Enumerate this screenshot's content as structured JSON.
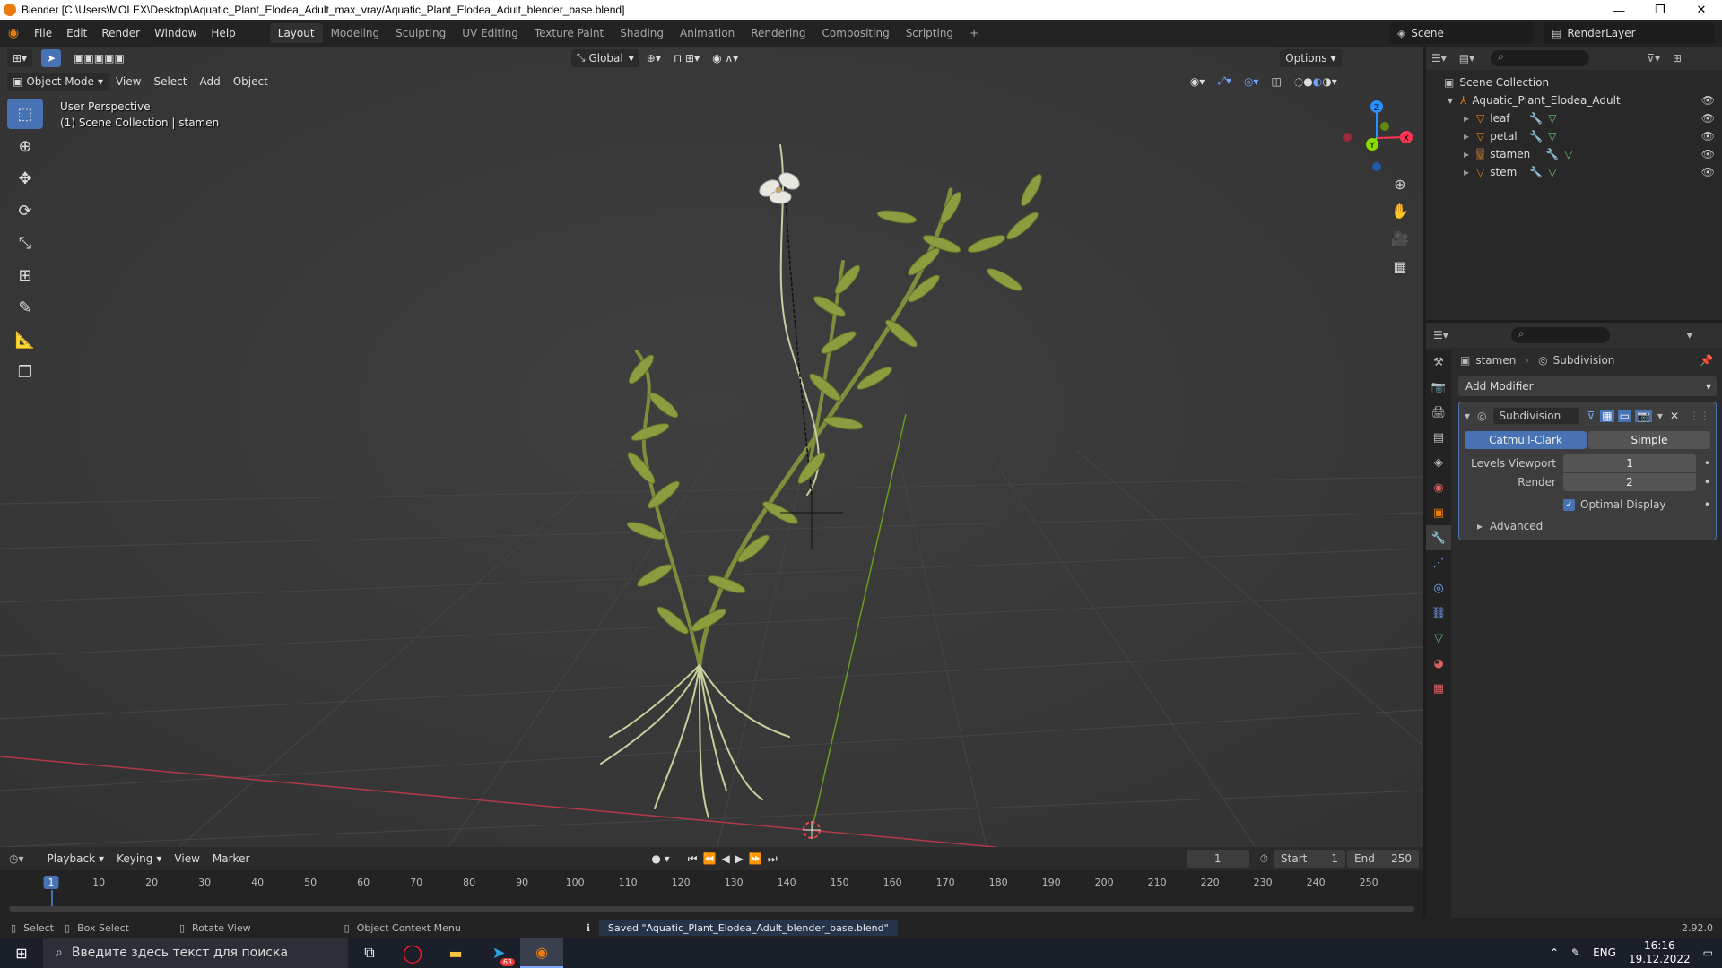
{
  "window": {
    "title": "Blender [C:\\Users\\MOLEX\\Desktop\\Aquatic_Plant_Elodea_Adult_max_vray/Aquatic_Plant_Elodea_Adult_blender_base.blend]",
    "minimize": "—",
    "restore": "❐",
    "close": "✕"
  },
  "menu": [
    "File",
    "Edit",
    "Render",
    "Window",
    "Help"
  ],
  "workspaces": [
    "Layout",
    "Modeling",
    "Sculpting",
    "UV Editing",
    "Texture Paint",
    "Shading",
    "Animation",
    "Rendering",
    "Compositing",
    "Scripting"
  ],
  "add_workspace": "+",
  "scene": {
    "name": "Scene",
    "render_layer": "RenderLayer"
  },
  "viewport": {
    "mode": "Object Mode",
    "menu": [
      "View",
      "Select",
      "Add",
      "Object"
    ],
    "orientation": "Global",
    "options": "Options",
    "info_line1": "User Perspective",
    "info_line2": "(1) Scene Collection | stamen",
    "gizmo": {
      "z": "Z",
      "y": "Y",
      "x": "X"
    }
  },
  "icons": {
    "tools": [
      "select-box-icon",
      "cursor-icon",
      "move-icon",
      "rotate-icon",
      "scale-icon",
      "transform-icon",
      "annotate-icon",
      "measure-icon",
      "add-cube-icon"
    ],
    "nav": [
      "zoom-icon",
      "pan-hand-icon",
      "camera-icon",
      "grid-icon"
    ]
  },
  "outliner": {
    "root": "Scene Collection",
    "collection": "Aquatic_Plant_Elodea_Adult",
    "items": [
      "leaf",
      "petal",
      "stamen",
      "stem"
    ]
  },
  "properties": {
    "object": "stamen",
    "modifier_context": "Subdivision",
    "add_modifier": "Add Modifier",
    "modifier": {
      "name": "Subdivision",
      "mode_catmull": "Catmull-Clark",
      "mode_simple": "Simple",
      "levels_viewport_label": "Levels Viewport",
      "levels_viewport": "1",
      "render_label": "Render",
      "render": "2",
      "optimal_display": "Optimal Display",
      "advanced": "Advanced"
    }
  },
  "timeline": {
    "menu": [
      "Playback",
      "Keying",
      "View",
      "Marker"
    ],
    "current_frame": "1",
    "start_label": "Start",
    "start": "1",
    "end_label": "End",
    "end": "250",
    "ruler": [
      "1",
      "10",
      "20",
      "30",
      "40",
      "50",
      "60",
      "70",
      "80",
      "90",
      "100",
      "110",
      "120",
      "130",
      "140",
      "150",
      "160",
      "170",
      "180",
      "190",
      "200",
      "210",
      "220",
      "230",
      "240",
      "250"
    ]
  },
  "status": {
    "select": "Select",
    "box_select": "Box Select",
    "rotate_view": "Rotate View",
    "context_menu": "Object Context Menu",
    "message": "Saved \"Aquatic_Plant_Elodea_Adult_blender_base.blend\"",
    "version": "2.92.0"
  },
  "taskbar": {
    "search_placeholder": "Введите здесь текст для поиска",
    "lang": "ENG",
    "time": "16:16",
    "date": "19.12.2022",
    "telegram_badge": "63"
  },
  "colors": {
    "accent": "#4772b3",
    "active_object": "#e87d0d",
    "x_axis": "#ff3352",
    "y_axis": "#8bdc00",
    "z_axis": "#2890ff"
  }
}
